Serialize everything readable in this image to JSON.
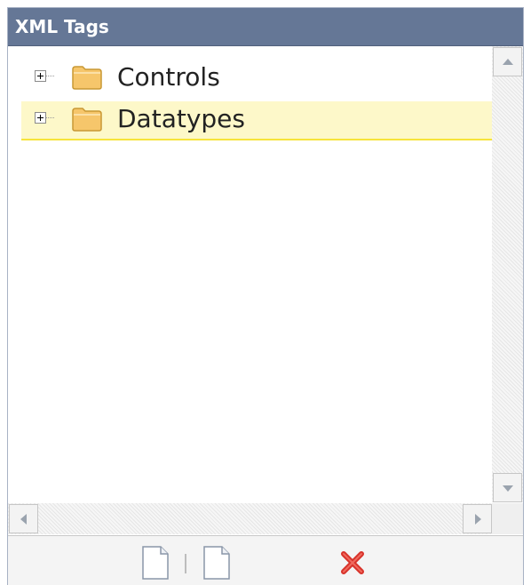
{
  "panel": {
    "title": "XML Tags"
  },
  "tree": {
    "items": [
      {
        "label": "Controls",
        "icon": "folder-icon",
        "expander": "plus",
        "selected": false
      },
      {
        "label": "Datatypes",
        "icon": "folder-icon",
        "expander": "plus",
        "selected": true
      }
    ]
  },
  "toolbar": {
    "buttons": [
      {
        "name": "new-document-button",
        "icon": "document-icon"
      },
      {
        "name": "new-document-button-2",
        "icon": "document-icon"
      },
      {
        "name": "delete-button",
        "icon": "red-x-icon"
      }
    ]
  },
  "colors": {
    "titlebar": "#657796",
    "selection_bg": "#fdf8c9",
    "selection_underline": "#f7e43a",
    "folder": "#f6c66b",
    "delete": "#d8322a"
  }
}
